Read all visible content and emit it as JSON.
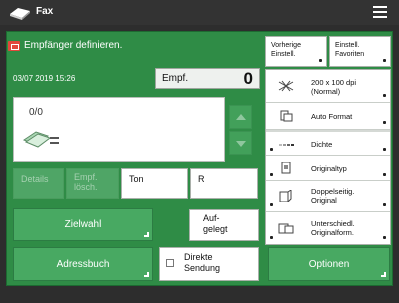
{
  "header": {
    "title": "Fax",
    "icon": "fax-icon",
    "menu_icon": "hamburger-menu-icon"
  },
  "message": {
    "icon": "recipient-warning-icon",
    "text": "Empfänger definieren."
  },
  "status": {
    "datetime": "03/07 2019 15:26",
    "recipients_label": "Empf.",
    "recipients_count": "0"
  },
  "recipient_list": {
    "counter": "0/0",
    "icon": "document-feed-icon"
  },
  "keys": {
    "details": "Details",
    "empf_loesch_line1": "Empf.",
    "empf_loesch_line2": "lösch.",
    "ton": "Ton",
    "r": "R"
  },
  "buttons": {
    "zielwahl": "Zielwahl",
    "adressbuch": "Adressbuch",
    "aufgelegt_line1": "Auf-",
    "aufgelegt_line2": "gelegt",
    "direkte_line1": "Direkte",
    "direkte_line2": "Sendung",
    "optionen": "Optionen"
  },
  "favorites": {
    "vorherige_line1": "Vorherige",
    "vorherige_line2": "Einstell.",
    "einstell_line1": "Einstell.",
    "einstell_line2": "Favoriten"
  },
  "settings": [
    {
      "line1": "200 x 100 dpi",
      "line2": "(Normal)",
      "icon": "resolution-icon"
    },
    {
      "line1": "Auto Format",
      "line2": "",
      "icon": "auto-format-icon"
    },
    {
      "line1": "Dichte",
      "line2": "",
      "icon": "density-icon"
    },
    {
      "line1": "Originaltyp",
      "line2": "",
      "icon": "original-type-icon"
    },
    {
      "line1": "Doppelseitig.",
      "line2": "Original",
      "icon": "duplex-original-icon"
    },
    {
      "line1": "Unterschiedl.",
      "line2": "Originalform.",
      "icon": "different-sizes-icon"
    }
  ],
  "colors": {
    "panel_green": "#2f8c46",
    "button_green": "#48a962",
    "top_bar": "#333333",
    "message_icon_red": "#e2473b"
  }
}
